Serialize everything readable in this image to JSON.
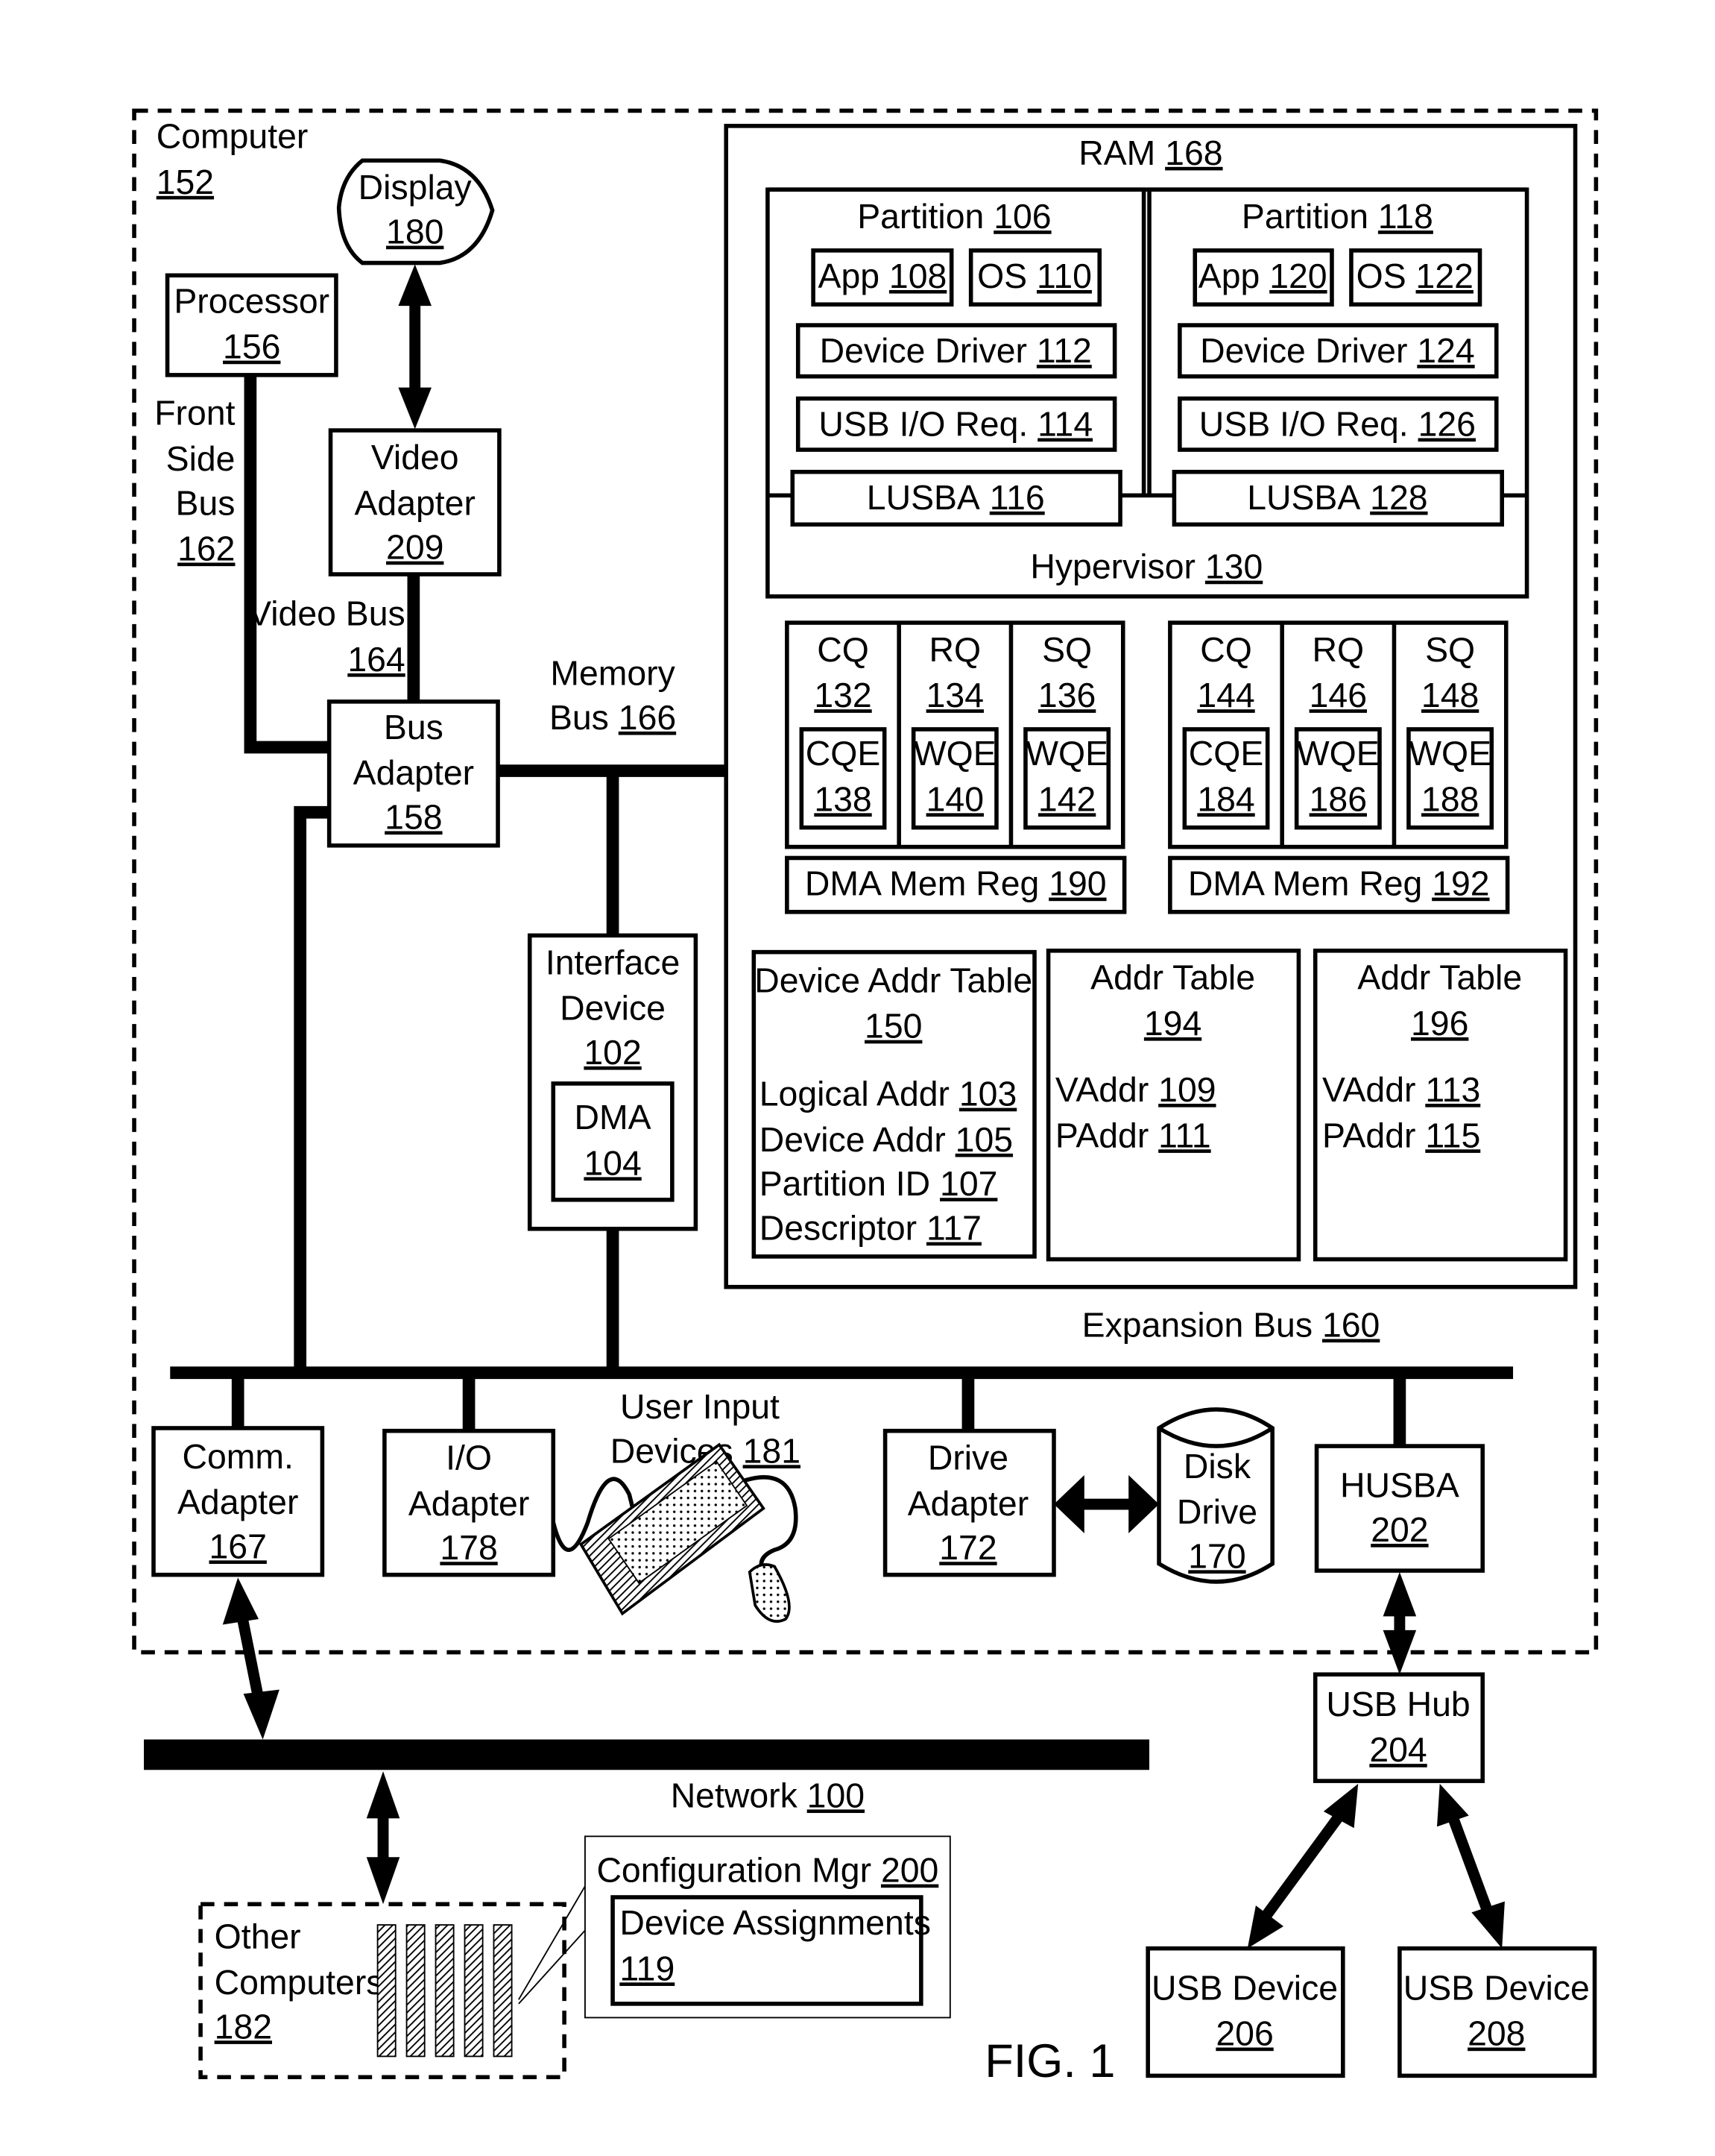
{
  "figure_label": "FIG. 1",
  "computer": {
    "name": "Computer",
    "ref": "152"
  },
  "display": {
    "name": "Display",
    "ref": "180"
  },
  "processor": {
    "name": "Processor",
    "ref": "156"
  },
  "front_side_bus": {
    "line1": "Front",
    "line2": "Side",
    "line3": "Bus",
    "ref": "162"
  },
  "video_adapter": {
    "line1": "Video",
    "line2": "Adapter",
    "ref": "209"
  },
  "video_bus": {
    "name": "Video Bus",
    "ref": "164"
  },
  "bus_adapter": {
    "line1": "Bus",
    "line2": "Adapter",
    "ref": "158"
  },
  "memory_bus": {
    "line1": "Memory",
    "line2": "Bus",
    "ref": "166"
  },
  "interface_device": {
    "line1": "Interface",
    "line2": "Device",
    "ref": "102",
    "dma": {
      "name": "DMA",
      "ref": "104"
    }
  },
  "ram": {
    "name": "RAM",
    "ref": "168",
    "hypervisor": {
      "name": "Hypervisor",
      "ref": "130"
    },
    "partitions": [
      {
        "name": "Partition",
        "ref": "106",
        "app": {
          "name": "App",
          "ref": "108"
        },
        "os": {
          "name": "OS",
          "ref": "110"
        },
        "driver": {
          "name": "Device Driver",
          "ref": "112"
        },
        "usb_req": {
          "name": "USB I/O Req.",
          "ref": "114"
        },
        "lusba": {
          "name": "LUSBA",
          "ref": "116"
        }
      },
      {
        "name": "Partition",
        "ref": "118",
        "app": {
          "name": "App",
          "ref": "120"
        },
        "os": {
          "name": "OS",
          "ref": "122"
        },
        "driver": {
          "name": "Device Driver",
          "ref": "124"
        },
        "usb_req": {
          "name": "USB I/O Req.",
          "ref": "126"
        },
        "lusba": {
          "name": "LUSBA",
          "ref": "128"
        }
      }
    ],
    "queue_groups": [
      {
        "queues": [
          {
            "name": "CQ",
            "ref": "132",
            "entry": {
              "name": "CQE",
              "ref": "138"
            }
          },
          {
            "name": "RQ",
            "ref": "134",
            "entry": {
              "name": "WQE",
              "ref": "140"
            }
          },
          {
            "name": "SQ",
            "ref": "136",
            "entry": {
              "name": "WQE",
              "ref": "142"
            }
          }
        ],
        "dma_region": {
          "name": "DMA Mem Reg",
          "ref": "190"
        }
      },
      {
        "queues": [
          {
            "name": "CQ",
            "ref": "144",
            "entry": {
              "name": "CQE",
              "ref": "184"
            }
          },
          {
            "name": "RQ",
            "ref": "146",
            "entry": {
              "name": "WQE",
              "ref": "186"
            }
          },
          {
            "name": "SQ",
            "ref": "148",
            "entry": {
              "name": "WQE",
              "ref": "188"
            }
          }
        ],
        "dma_region": {
          "name": "DMA Mem Reg",
          "ref": "192"
        }
      }
    ],
    "device_addr_table": {
      "name": "Device Addr Table",
      "ref": "150",
      "fields": [
        {
          "name": "Logical Addr",
          "ref": "103"
        },
        {
          "name": "Device Addr",
          "ref": "105"
        },
        {
          "name": "Partition ID",
          "ref": "107"
        },
        {
          "name": "Descriptor",
          "ref": "117"
        }
      ]
    },
    "addr_tables": [
      {
        "name": "Addr Table",
        "ref": "194",
        "fields": [
          {
            "name": "VAddr",
            "ref": "109"
          },
          {
            "name": "PAddr",
            "ref": "111"
          }
        ]
      },
      {
        "name": "Addr Table",
        "ref": "196",
        "fields": [
          {
            "name": "VAddr",
            "ref": "113"
          },
          {
            "name": "PAddr",
            "ref": "115"
          }
        ]
      }
    ]
  },
  "expansion_bus": {
    "name": "Expansion Bus",
    "ref": "160"
  },
  "comm_adapter": {
    "line1": "Comm.",
    "line2": "Adapter",
    "ref": "167"
  },
  "io_adapter": {
    "line1": "I/O",
    "line2": "Adapter",
    "ref": "178"
  },
  "user_input": {
    "line1": "User Input",
    "line2": "Devices",
    "ref": "181"
  },
  "drive_adapter": {
    "line1": "Drive",
    "line2": "Adapter",
    "ref": "172"
  },
  "disk_drive": {
    "line1": "Disk",
    "line2": "Drive",
    "ref": "170"
  },
  "husba": {
    "name": "HUSBA",
    "ref": "202"
  },
  "network": {
    "name": "Network",
    "ref": "100"
  },
  "other_computers": {
    "line1": "Other",
    "line2": "Computers",
    "ref": "182"
  },
  "config_mgr": {
    "name": "Configuration Mgr",
    "ref": "200",
    "assignments": {
      "name": "Device Assignments",
      "ref": "119"
    }
  },
  "usb_hub": {
    "name": "USB Hub",
    "ref": "204"
  },
  "usb_devices": [
    {
      "name": "USB Device",
      "ref": "206"
    },
    {
      "name": "USB Device",
      "ref": "208"
    }
  ]
}
